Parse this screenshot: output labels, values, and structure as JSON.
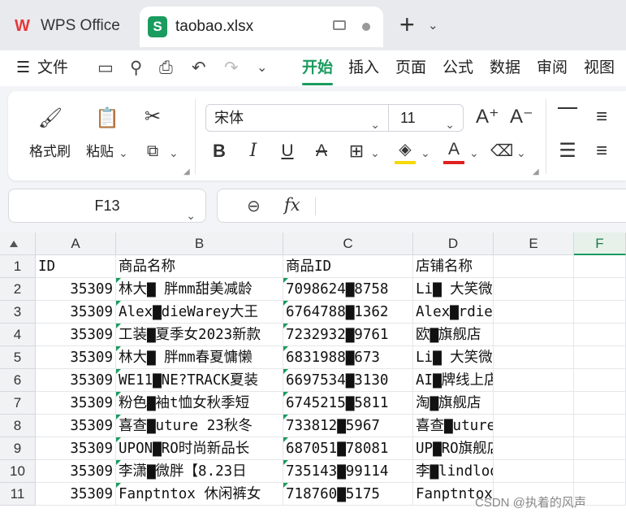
{
  "titlebar": {
    "app_tab": "WPS Office",
    "file_tab": "taobao.xlsx"
  },
  "menu": {
    "file": "文件",
    "items": [
      "开始",
      "插入",
      "页面",
      "公式",
      "数据",
      "审阅",
      "视图"
    ]
  },
  "ribbon": {
    "format_painter": "格式刷",
    "paste": "粘贴",
    "font_name": "宋体",
    "font_size": "11"
  },
  "formula_bar": {
    "cell_ref": "F13",
    "fx": "fx",
    "content": ""
  },
  "sheet": {
    "columns": [
      "A",
      "B",
      "C",
      "D",
      "E",
      "F"
    ],
    "rows": [
      "1",
      "2",
      "3",
      "4",
      "5",
      "6",
      "7",
      "8",
      "9",
      "10",
      "11"
    ],
    "header_row": [
      "ID",
      "商品名称",
      "商品ID",
      "店铺名称"
    ],
    "data": [
      [
        "35309",
        "林大▇ 胖mm甜美减龄",
        "7098624▇8758",
        "Li▇ 大笑微胖定制"
      ],
      [
        "35309",
        "Alex▇dieWarey大王",
        "6764788▇1362",
        "Alex▇rdieWarey"
      ],
      [
        "35309",
        "工装▇夏季女2023新款",
        "7232932▇9761",
        "欧▇旗舰店"
      ],
      [
        "35309",
        "林大▇ 胖mm春夏慵懒",
        "6831988▇673",
        "Li▇ 大笑微胖定制"
      ],
      [
        "35309",
        "WE11▇NE?TRACK夏装",
        "6697534▇3130",
        "AI▇牌线上店"
      ],
      [
        "35309",
        "粉色▇袖t恤女秋季短",
        "6745215▇5811",
        "淘▇旗舰店"
      ],
      [
        "35309",
        "喜查▇uture 23秋冬",
        "733812▇5967",
        "喜查▇uture"
      ],
      [
        "35309",
        "UPON▇RO时尚新品长",
        "687051▇78081",
        "UP▇RO旗舰店"
      ],
      [
        "35309",
        "李潇▇微胖【8.23日",
        "735143▇99114",
        "李▇lindlook微胖定制"
      ],
      [
        "35309",
        "Fanptntox 休闲裤女",
        "718760▇5175",
        "Fanptntox"
      ]
    ]
  },
  "watermark": "CSDN @执着的风声",
  "colors": {
    "accent": "#1a9b5f",
    "wps_red": "#e43a3a"
  }
}
